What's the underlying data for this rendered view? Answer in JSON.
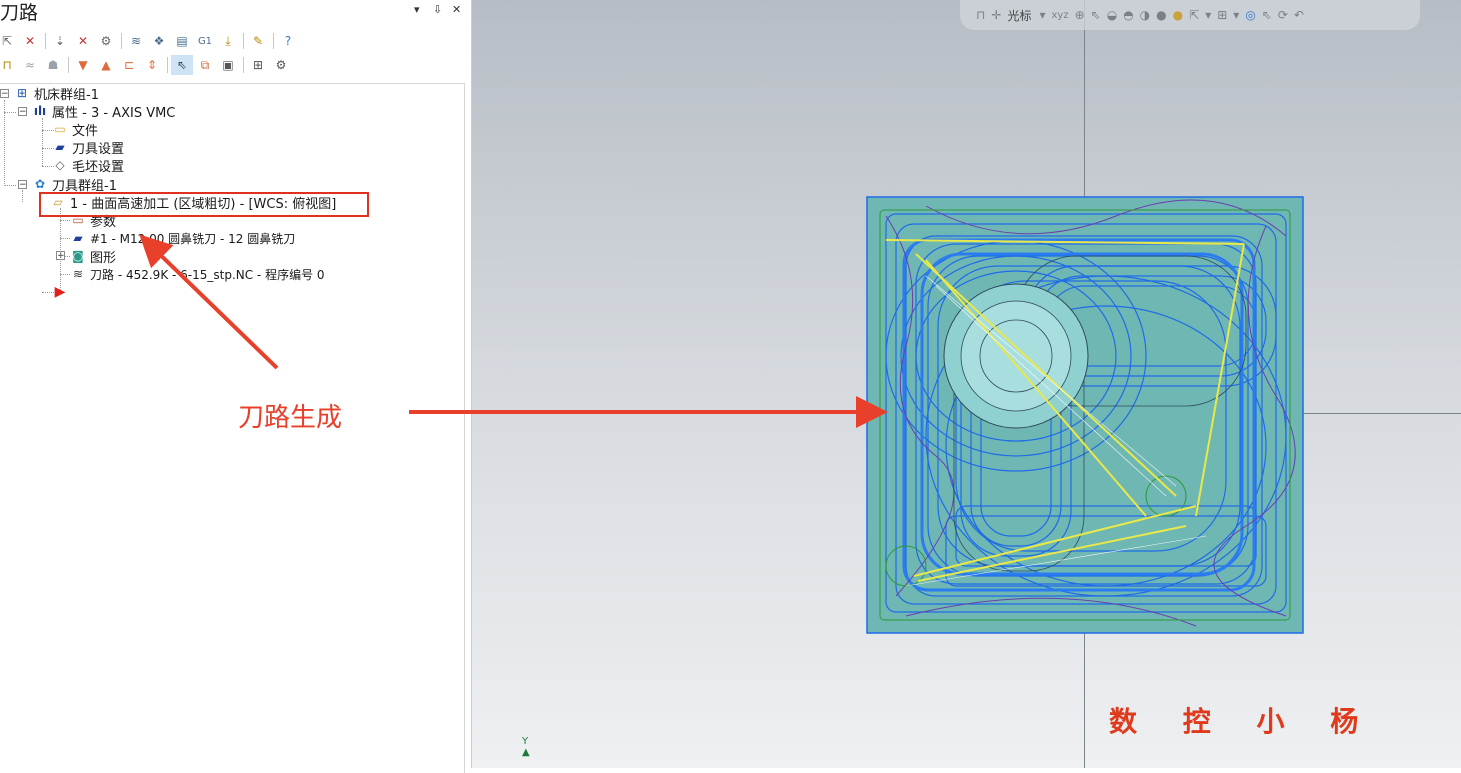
{
  "panel": {
    "title": "刀路",
    "controls": [
      "▾",
      "⇩",
      "✕"
    ]
  },
  "toolbar_row1": [
    "select-icon",
    "deselect-icon",
    "toggle-icon",
    "select-toolpath-icon",
    "delete-icon",
    "regenerate-icon",
    "stack-icon",
    "sim-icon",
    "verify-icon",
    "g1-icon",
    "post-icon",
    "lock-icon",
    "help-icon"
  ],
  "toolbar_row2": [
    "lock-icon",
    "wave-icon",
    "ghost-icon",
    "move-down-icon",
    "move-up-icon",
    "insert-icon",
    "sort-icon",
    "select-all-icon",
    "copy-icon",
    "view-icon",
    "compact-icon",
    "options-icon"
  ],
  "tree": {
    "machine_group": "机床群组-1",
    "properties": "属性 - 3 - AXIS VMC",
    "files": "文件",
    "tool_settings": "刀具设置",
    "stock_setup": "毛坯设置",
    "toolpath_group": "刀具群组-1",
    "operation": "1 - 曲面高速加工 (区域粗切) - [WCS: 俯视图]",
    "parameters": "参数",
    "tool": "#1 - M12.00 圆鼻铣刀 - 12 圆鼻铣刀",
    "geometry": "图形",
    "toolpath": "刀路 - 452.9K - 6-15_stp.NC - 程序编号 0"
  },
  "annotation": {
    "label": "刀路生成",
    "color": "#e8402a"
  },
  "viewport": {
    "cursor_label": "光标",
    "watermark": "数 控 小 杨",
    "axis_label": "Y",
    "stock_color": "#6fb7b3",
    "toolpath_color": "#1f6be8"
  }
}
